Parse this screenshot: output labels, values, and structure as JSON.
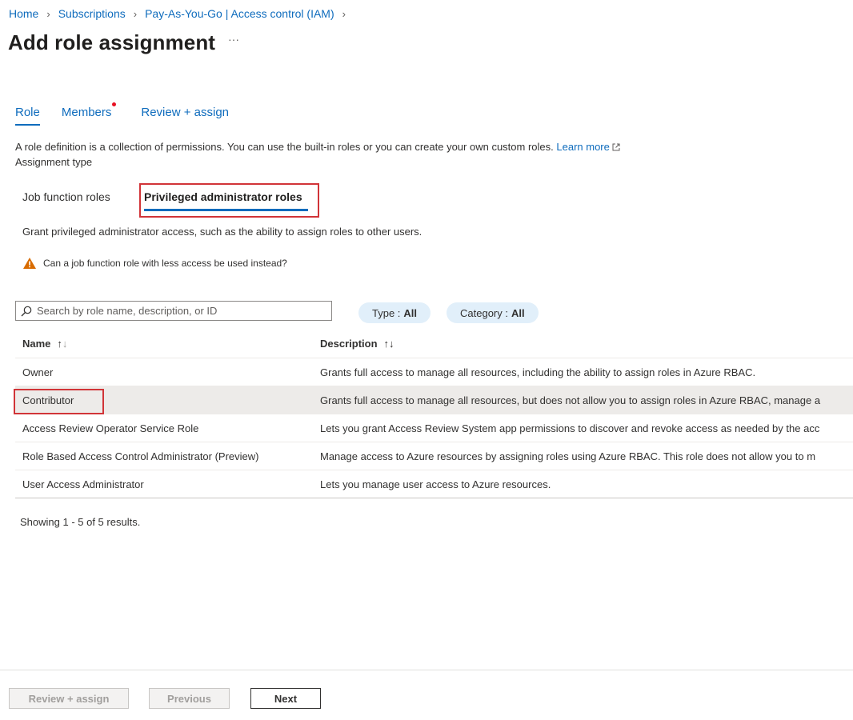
{
  "breadcrumb": [
    "Home",
    "Subscriptions",
    "Pay-As-You-Go | Access control (IAM)"
  ],
  "page_title": "Add role assignment",
  "more_label": "···",
  "tabs": [
    {
      "label": "Role",
      "active": true
    },
    {
      "label": "Members",
      "has_dot": true
    },
    {
      "label": "Review + assign"
    }
  ],
  "intro_text": "A role definition is a collection of permissions. You can use the built-in roles or you can create your own custom roles.",
  "learn_more": "Learn more",
  "assignment_type_label": "Assignment type",
  "subtabs": [
    "Job function roles",
    "Privileged administrator roles"
  ],
  "grant_text": "Grant privileged administrator access, such as the ability to assign roles to other users.",
  "warning_text": "Can a job function role with less access be used instead?",
  "search": {
    "placeholder": "Search by role name, description, or ID",
    "value": ""
  },
  "filters": {
    "type": {
      "label": "Type :",
      "value": "All"
    },
    "category": {
      "label": "Category :",
      "value": "All"
    }
  },
  "table": {
    "headers": {
      "name": "Name",
      "description": "Description"
    },
    "rows": [
      {
        "name": "Owner",
        "description": "Grants full access to manage all resources, including the ability to assign roles in Azure RBAC."
      },
      {
        "name": "Contributor",
        "description": "Grants full access to manage all resources, but does not allow you to assign roles in Azure RBAC, manage a",
        "selected": true
      },
      {
        "name": "Access Review Operator Service Role",
        "description": "Lets you grant Access Review System app permissions to discover and revoke access as needed by the acc"
      },
      {
        "name": "Role Based Access Control Administrator (Preview)",
        "description": "Manage access to Azure resources by assigning roles using Azure RBAC. This role does not allow you to m"
      },
      {
        "name": "User Access Administrator",
        "description": "Lets you manage user access to Azure resources."
      }
    ]
  },
  "showing_text": "Showing 1 - 5 of 5 results.",
  "footer": {
    "review_assign": "Review + assign",
    "previous": "Previous",
    "next": "Next"
  },
  "colors": {
    "accent": "#0f6cbd",
    "highlight_border": "#d13438",
    "warning": "#d86b00",
    "pill_bg": "#e1effa"
  }
}
